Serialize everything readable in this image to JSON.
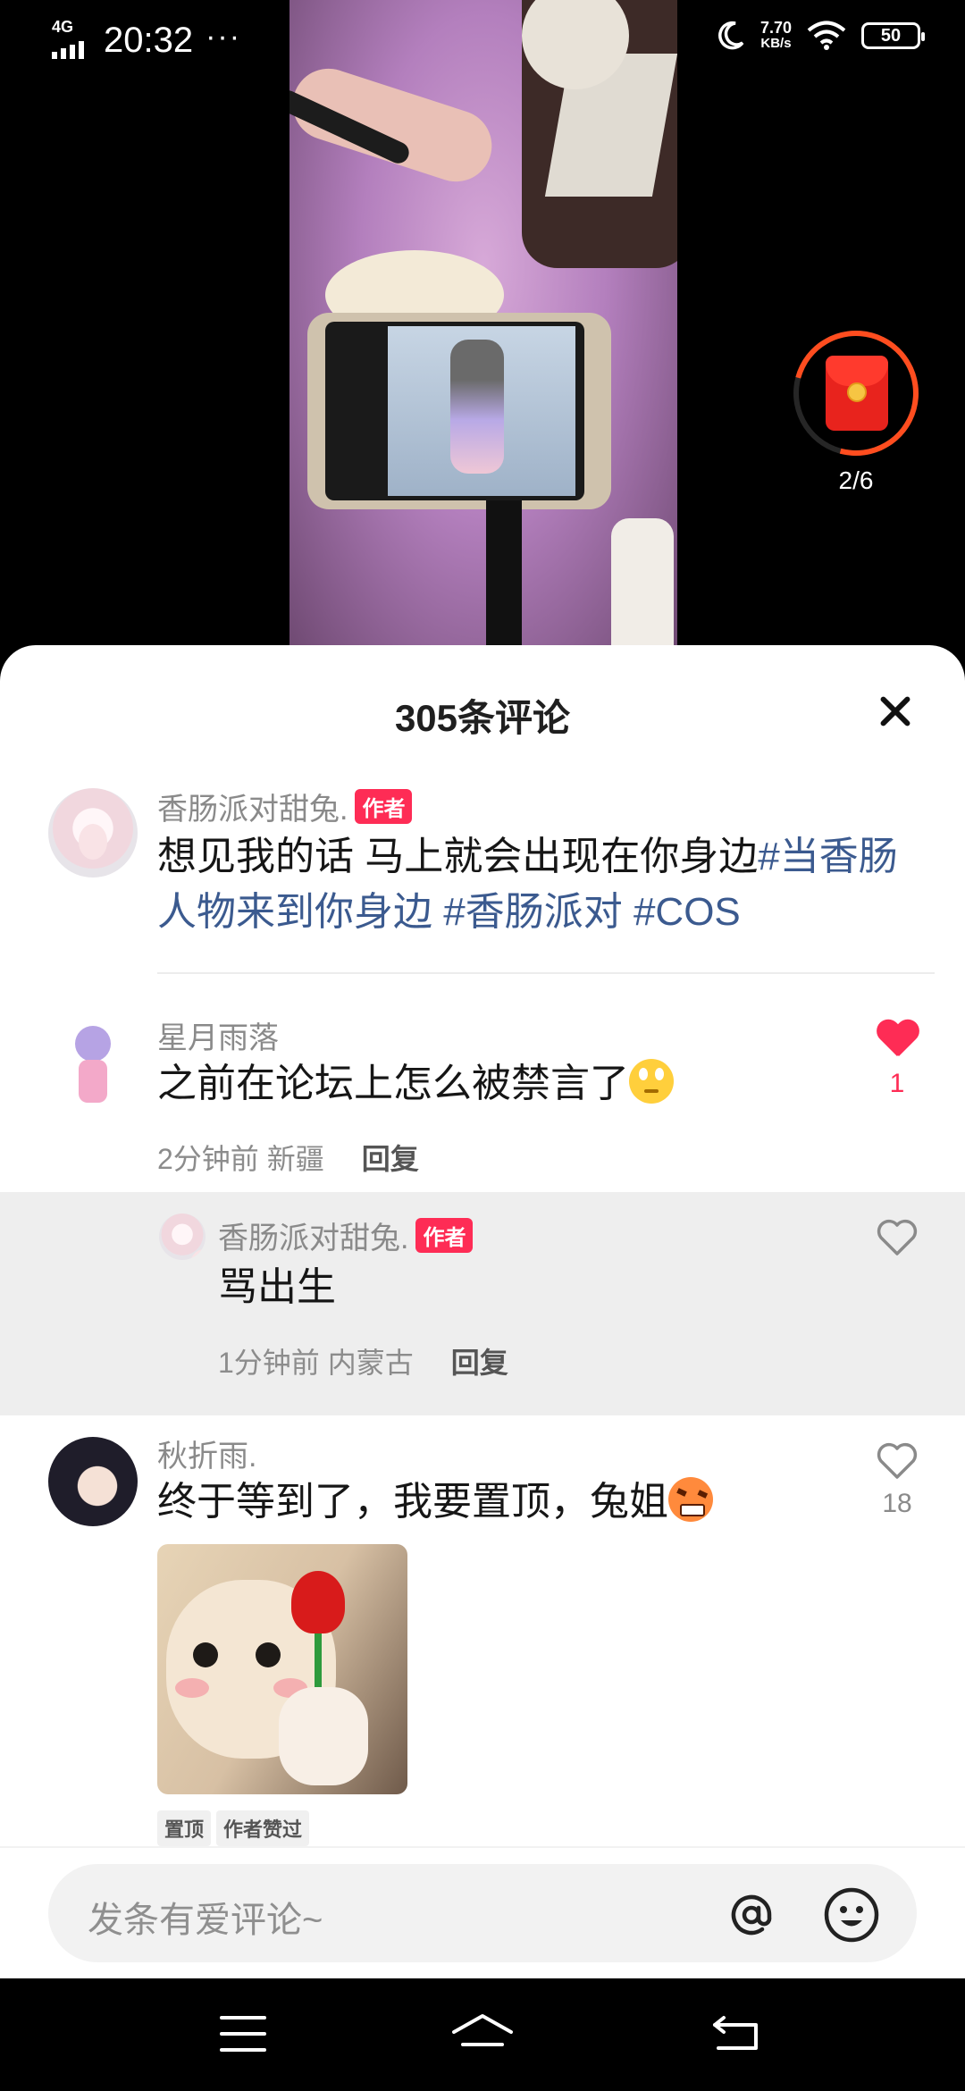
{
  "status_bar": {
    "network": "4G",
    "time": "20:32",
    "more": "···",
    "speed_value": "7.70",
    "speed_unit": "KB/s",
    "battery": "50"
  },
  "red_envelope": {
    "progress": "2/6",
    "progress_fraction": 0.33
  },
  "comments_panel": {
    "title": "305条评论",
    "comments": [
      {
        "user": "香肠派对甜兔.",
        "badge": "作者",
        "text_plain": "想见我的话 马上就会出现在你身边",
        "text_tag1": "#当香肠人物来到你身边",
        "text_tag2": "#香肠派对",
        "text_tag3": "#COS"
      },
      {
        "user": "星月雨落",
        "text": "之前在论坛上怎么被禁言了",
        "time": "2分钟前",
        "location": "新疆",
        "reply_label": "回复",
        "likes": "1",
        "liked": true
      },
      {
        "user": "香肠派对甜兔.",
        "badge": "作者",
        "text": "骂出生",
        "time": "1分钟前",
        "location": "内蒙古",
        "reply_label": "回复",
        "liked": false
      },
      {
        "user": "秋折雨.",
        "text": "终于等到了，我要置顶，兔姐",
        "likes": "18",
        "liked": false,
        "tags": [
          "置顶",
          "作者赞过"
        ]
      }
    ]
  },
  "input_bar": {
    "placeholder": "发条有爱评论~"
  },
  "colors": {
    "accent": "#fe2c55",
    "hashtag": "#3b5a8f",
    "progress_ring": "#ff4d1f"
  },
  "icons": [
    "signal-icon",
    "moon-icon",
    "wifi-icon",
    "battery-icon",
    "red-envelope-icon",
    "close-icon",
    "heart-icon",
    "at-icon",
    "emoji-icon",
    "menu-icon",
    "home-icon",
    "back-icon"
  ]
}
